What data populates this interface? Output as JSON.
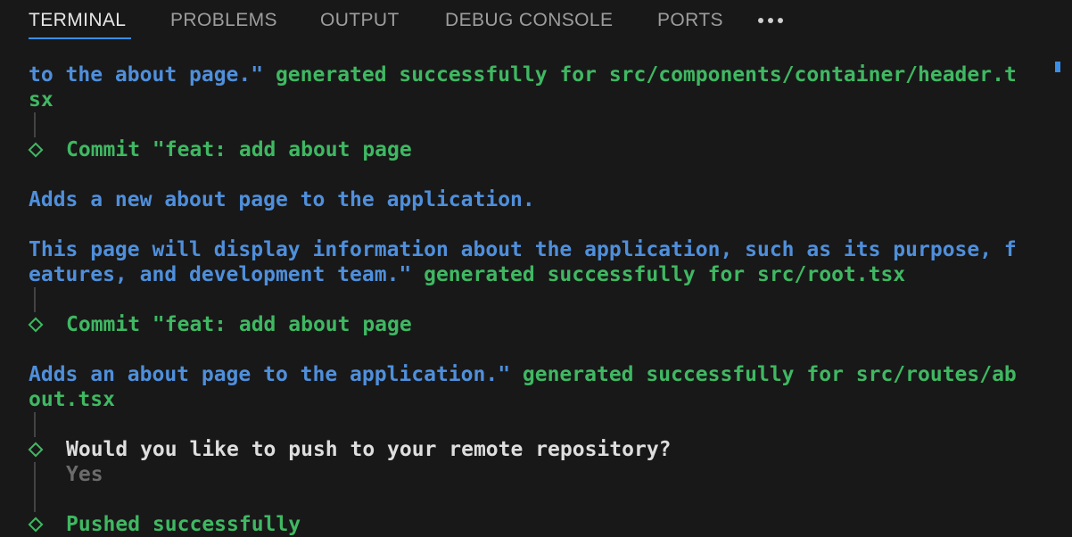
{
  "tabs": [
    {
      "label": "TERMINAL"
    },
    {
      "label": "PROBLEMS"
    },
    {
      "label": "OUTPUT"
    },
    {
      "label": "DEBUG CONSOLE"
    },
    {
      "label": "PORTS"
    }
  ],
  "active_tab": "TERMINAL",
  "more_icon": "more-horizontal-icon",
  "colors": {
    "background": "#181818",
    "accent": "#3a8ee6",
    "commit_text": "#4f8fdb",
    "success_text": "#3fb862",
    "prompt_text": "#dedede",
    "muted_text": "#6b6b6b"
  },
  "terminal": {
    "l1_commit": "to the about page.\"",
    "l1_status": " generated successfully for src/components/container/header.t",
    "l2": "sx",
    "step1": "Commit \"feat: add about page",
    "l5": "Adds a new about page to the application.",
    "l7": "This page will display information about the application, such as its purpose, f",
    "l8_commit": "eatures, and development team.\"",
    "l8_status": " generated successfully for src/root.tsx",
    "step2": "Commit \"feat: add about page",
    "l12_commit": "Adds an about page to the application.\"",
    "l12_status": " generated successfully for src/routes/ab",
    "l13": "out.tsx",
    "question": "Would you like to push to your remote repository?",
    "answer": "Yes",
    "result": "Pushed successfully"
  }
}
